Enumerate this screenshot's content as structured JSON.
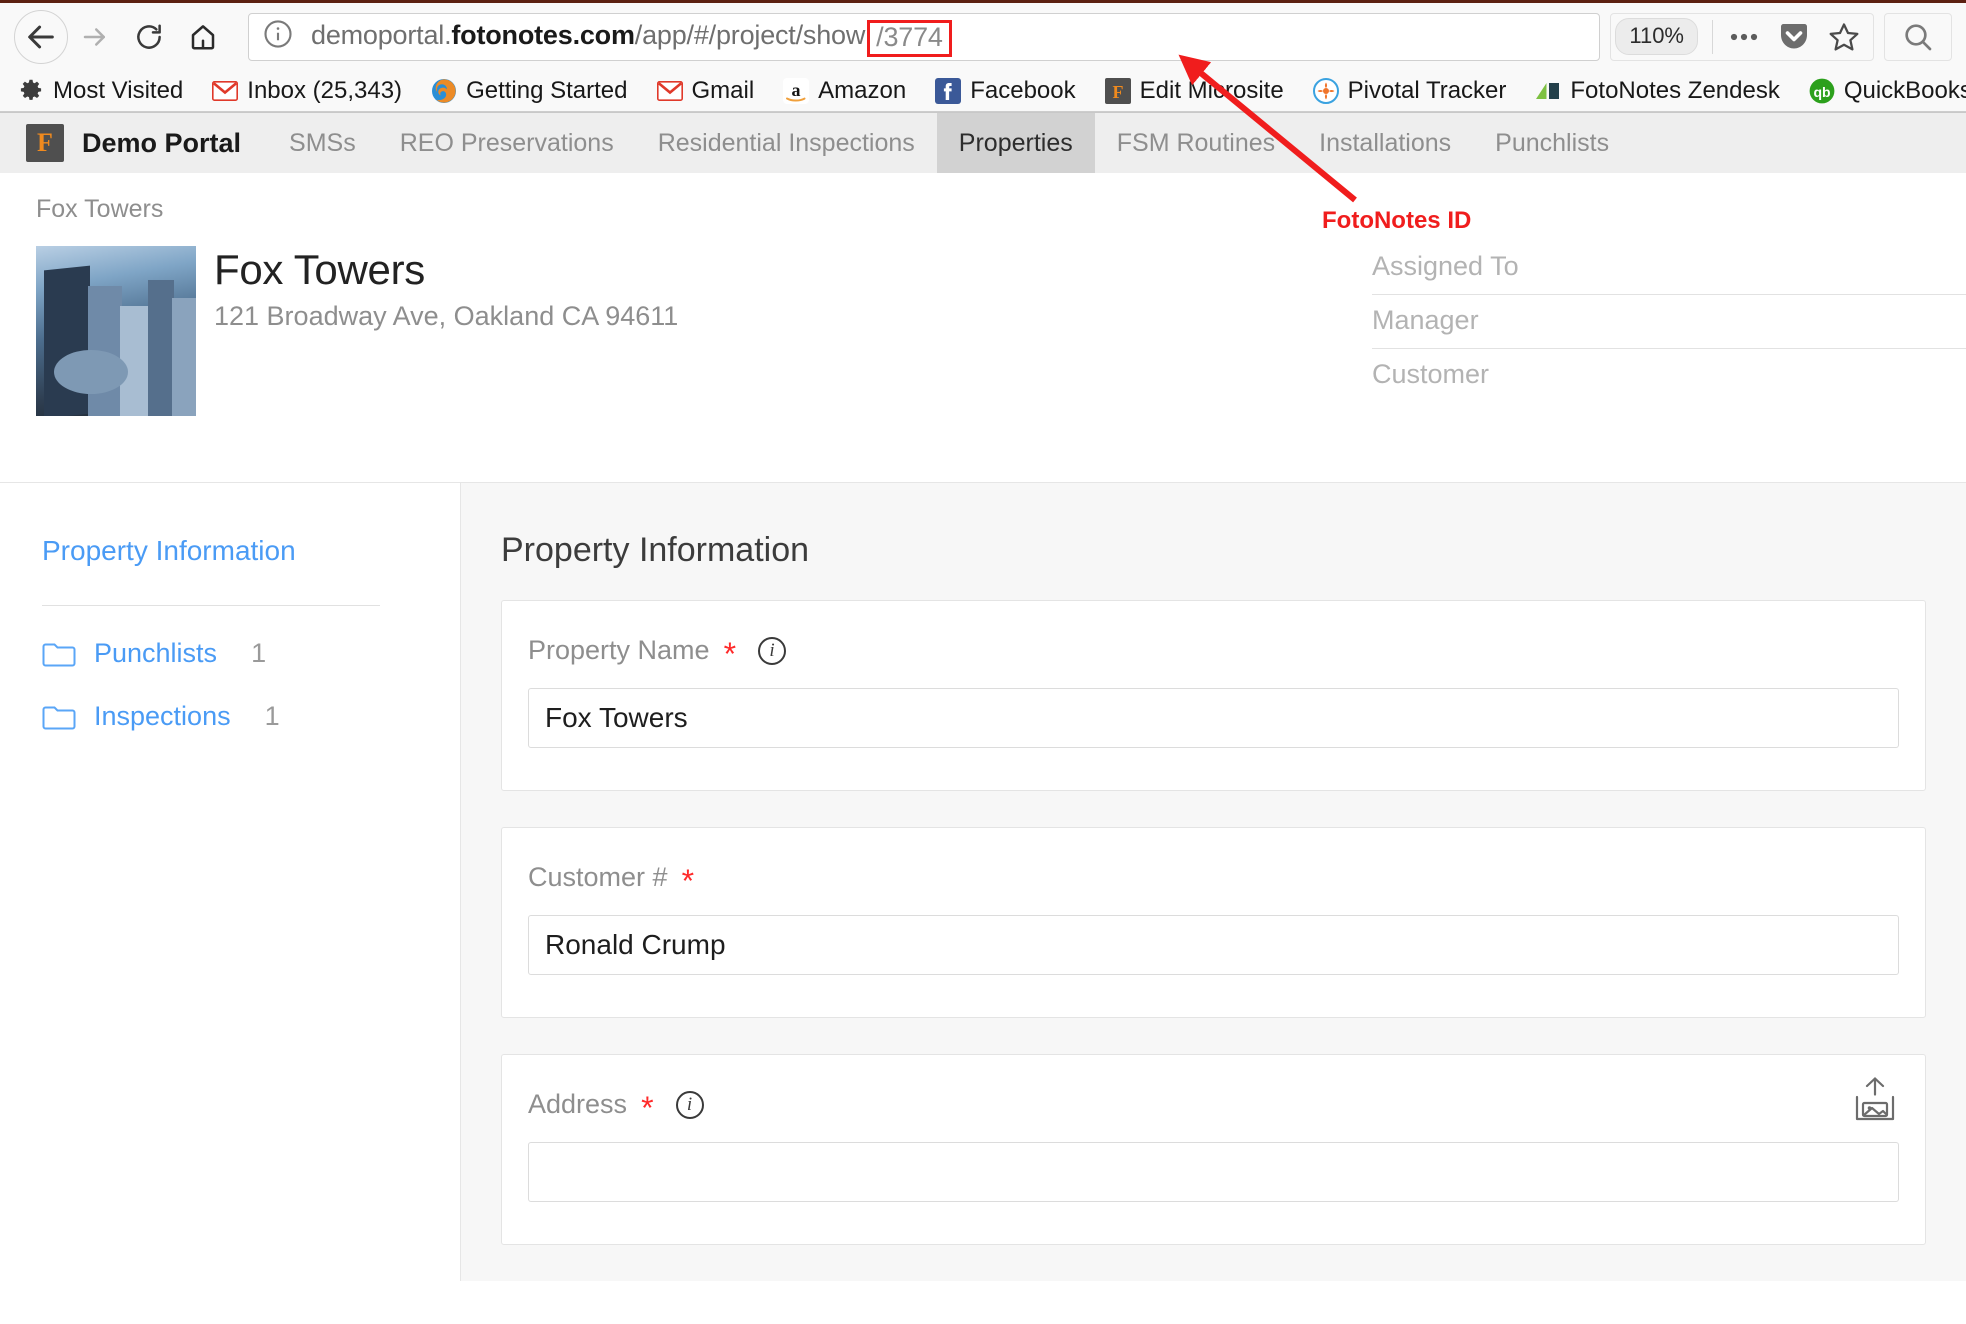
{
  "browser": {
    "nav": {
      "back": "back-arrow",
      "forward": "forward-arrow",
      "reload": "reload",
      "home": "home"
    },
    "url": {
      "info_icon": "info-icon",
      "prefix": "demoportal.",
      "domain": "fotonotes.com",
      "path": "/app/#/project/show",
      "separator": "/",
      "highlighted_id": "3774",
      "full": "demoportal.fotonotes.com/app/#/project/show/3774"
    },
    "zoom_level": "110%",
    "toolbar_icons": [
      "more-menu-icon",
      "pocket-icon",
      "bookmark-star-icon",
      "search-icon"
    ],
    "bookmarks": [
      {
        "label": "Most Visited",
        "icon": "gear-icon"
      },
      {
        "label": "Inbox (25,343)",
        "icon": "gmail-icon"
      },
      {
        "label": "Getting Started",
        "icon": "firefox-icon"
      },
      {
        "label": "Gmail",
        "icon": "gmail-icon"
      },
      {
        "label": "Amazon",
        "icon": "amazon-icon"
      },
      {
        "label": "Facebook",
        "icon": "facebook-icon"
      },
      {
        "label": "Edit Microsite",
        "icon": "fotonotes-icon"
      },
      {
        "label": "Pivotal Tracker",
        "icon": "pivotal-icon"
      },
      {
        "label": "FotoNotes Zendesk",
        "icon": "zendesk-icon"
      },
      {
        "label": "QuickBooks",
        "icon": "quickbooks-icon"
      }
    ]
  },
  "app": {
    "brand": {
      "logo_letter": "F",
      "name": "Demo Portal"
    },
    "tabs": [
      {
        "label": "SMSs",
        "active": false
      },
      {
        "label": "REO Preservations",
        "active": false
      },
      {
        "label": "Residential Inspections",
        "active": false
      },
      {
        "label": "Properties",
        "active": true
      },
      {
        "label": "FSM Routines",
        "active": false
      },
      {
        "label": "Installations",
        "active": false
      },
      {
        "label": "Punchlists",
        "active": false
      }
    ]
  },
  "annotation": {
    "label": "FotoNotes ID",
    "color": "#f01d1d"
  },
  "property": {
    "breadcrumb": "Fox Towers",
    "title": "Fox Towers",
    "address": "121 Broadway Ave, Oakland CA 94611",
    "thumbnail_alt": "city-skyline-photo",
    "meta": [
      {
        "label": "Assigned To",
        "value": ""
      },
      {
        "label": "Manager",
        "value": ""
      },
      {
        "label": "Customer",
        "value": ""
      }
    ]
  },
  "sidebar": {
    "title": "Property Information",
    "items": [
      {
        "label": "Punchlists",
        "count": "1",
        "icon": "folder-icon"
      },
      {
        "label": "Inspections",
        "count": "1",
        "icon": "folder-icon"
      }
    ]
  },
  "main": {
    "title": "Property Information",
    "fields": [
      {
        "label": "Property Name",
        "required": "*",
        "has_info": true,
        "value": "Fox Towers",
        "placeholder": ""
      },
      {
        "label": "Customer #",
        "required": "*",
        "has_info": false,
        "value": "Ronald Crump",
        "placeholder": ""
      },
      {
        "label": "Address",
        "required": "*",
        "has_info": true,
        "value": "",
        "placeholder": ""
      }
    ],
    "upload_icon": "image-upload-icon"
  },
  "colors": {
    "accent_link": "#4a9bf5",
    "annotation_red": "#f01d1d",
    "brand_orange": "#f08a1e",
    "nav_active_bg": "#d2d2d2"
  }
}
